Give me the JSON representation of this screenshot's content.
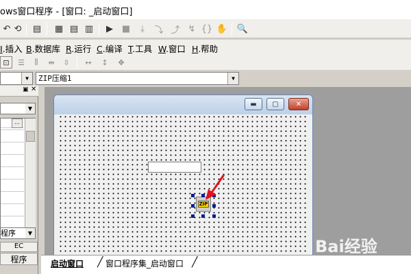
{
  "window": {
    "title": "ows窗口程序 - [窗口: _启动窗口]"
  },
  "toolbar1": {
    "icons": [
      "undo-icon",
      "redo-icon",
      "find-icon",
      "layout-icon",
      "layout2-icon",
      "layout3-icon",
      "run-icon",
      "stop-icon",
      "step-icon"
    ]
  },
  "menu": {
    "items": [
      {
        "key": "I",
        "label": ".插入"
      },
      {
        "key": "B",
        "label": ".数据库"
      },
      {
        "key": "R",
        "label": ".运行"
      },
      {
        "key": "C",
        "label": ".编译"
      },
      {
        "key": "T",
        "label": ".工具"
      },
      {
        "key": "W",
        "label": ".窗口"
      },
      {
        "key": "H",
        "label": ".帮助"
      }
    ]
  },
  "property": {
    "component_combo_value": "ZIP压缩1"
  },
  "leftpanel": {
    "combo_value": "程序",
    "tab_ec": "EC",
    "tab_program": "程序",
    "ellipsis": "..."
  },
  "form": {
    "textbox_value": "",
    "zip_icon_label": "ZIP"
  },
  "tabs": [
    {
      "label": "启动窗口"
    },
    {
      "label": "窗口程序集_启动窗口"
    }
  ],
  "watermark": {
    "text": "Bai经验"
  },
  "colors": {
    "selection_handles": "#0a1e8c",
    "arrow": "#e0141e"
  }
}
